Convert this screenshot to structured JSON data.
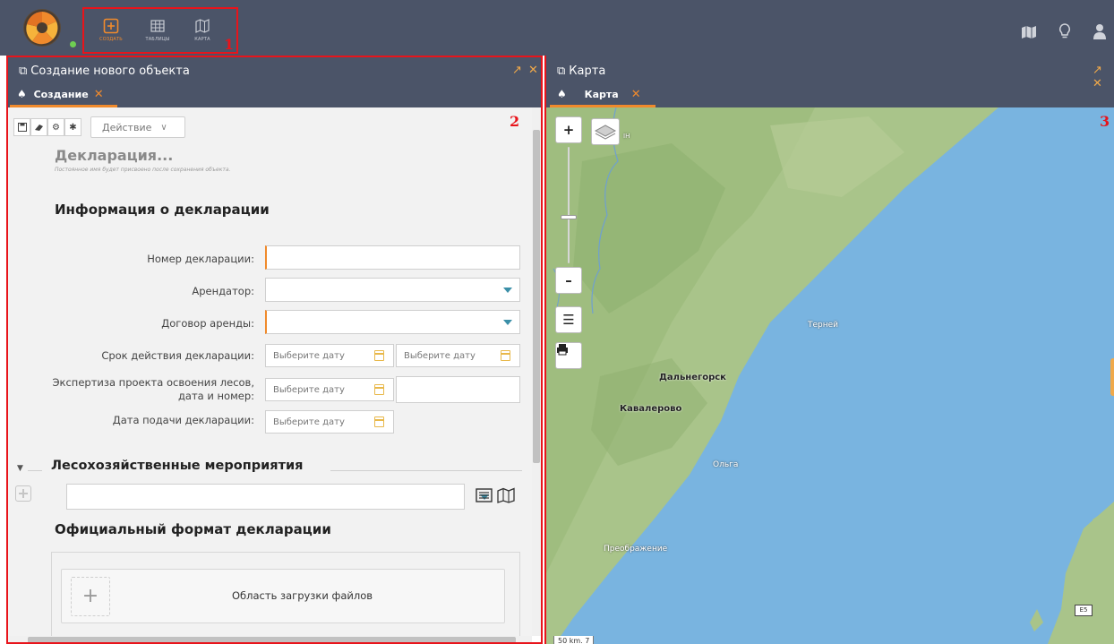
{
  "topbar": {
    "nav": [
      {
        "label": "СОЗДАТЬ",
        "icon": "plus-square-icon",
        "active": true
      },
      {
        "label": "ТАБЛИЦЫ",
        "icon": "table-icon",
        "active": false
      },
      {
        "label": "КАРТА",
        "icon": "map-icon",
        "active": false
      }
    ],
    "marker_1": "1",
    "right_icons": [
      "map-book-icon",
      "lightbulb-icon",
      "user-icon"
    ]
  },
  "left_panel": {
    "title": "Создание нового объекта",
    "tab_label": "Создание",
    "marker_2": "2",
    "toolbar": {
      "action_label": "Действие",
      "buttons": [
        "save-icon",
        "eraser-icon",
        "gears-icon",
        "gear-icon"
      ]
    },
    "declaration_title": "Декларация...",
    "declaration_note": "Постоянное имя будет присвоено после сохранения объекта.",
    "section_info": "Информация о декларации",
    "fields": {
      "number_label": "Номер декларации:",
      "tenant_label": "Арендатор:",
      "lease_label": "Договор аренды:",
      "validity_label": "Срок действия декларации:",
      "expertise_label_1": "Экспертиза проекта освоения лесов,",
      "expertise_label_2": "дата и номер:",
      "submit_label": "Дата подачи декларации:",
      "date_placeholder": "Выберите дату"
    },
    "section_forest": "Лесохозяйственные мероприятия",
    "section_format": "Официальный формат декларации",
    "upload_text": "Область загрузки файлов"
  },
  "right_panel": {
    "title": "Карта",
    "tab_label": "Карта",
    "marker_3": "3",
    "map": {
      "cities": {
        "terney": "Терней",
        "dalnegorsk": "Дальнегорск",
        "kavalerovo": "Кавалерово",
        "olga": "Ольга",
        "preobrazhenie": "Преображение",
        "partial": "ІН"
      },
      "scale": "50 km. 7",
      "road_sign": "E5"
    }
  }
}
